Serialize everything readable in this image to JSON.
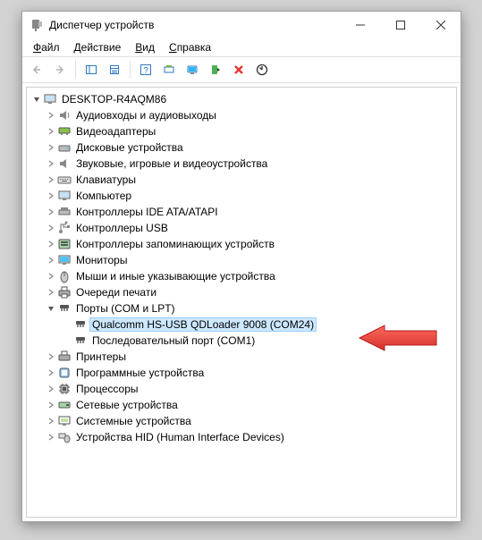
{
  "titlebar": {
    "title": "Диспетчер устройств"
  },
  "menu": {
    "file": {
      "key": "Ф",
      "rest": "айл"
    },
    "action": {
      "key": "Д",
      "rest": "ействие"
    },
    "view": {
      "key": "В",
      "rest": "ид"
    },
    "help": {
      "key": "С",
      "rest": "правка"
    }
  },
  "tree": {
    "root": "DESKTOP-R4AQM86",
    "nodes": {
      "audio": "Аудиовходы и аудиовыходы",
      "video": "Видеоадаптеры",
      "disks": "Дисковые устройства",
      "soundgame": "Звуковые, игровые и видеоустройства",
      "keyboards": "Клавиатуры",
      "computer": "Компьютер",
      "ide": "Контроллеры IDE ATA/ATAPI",
      "usbctrl": "Контроллеры USB",
      "storage": "Контроллеры запоминающих устройств",
      "monitors": "Мониторы",
      "mice": "Мыши и иные указывающие устройства",
      "printqueue": "Очереди печати",
      "ports": "Порты (COM и LPT)",
      "ports_qc": "Qualcomm HS-USB QDLoader 9008 (COM24)",
      "ports_com1": "Последовательный порт (COM1)",
      "printers": "Принтеры",
      "software": "Программные устройства",
      "cpus": "Процессоры",
      "network": "Сетевые устройства",
      "system": "Системные устройства",
      "hid": "Устройства HID (Human Interface Devices)"
    }
  }
}
